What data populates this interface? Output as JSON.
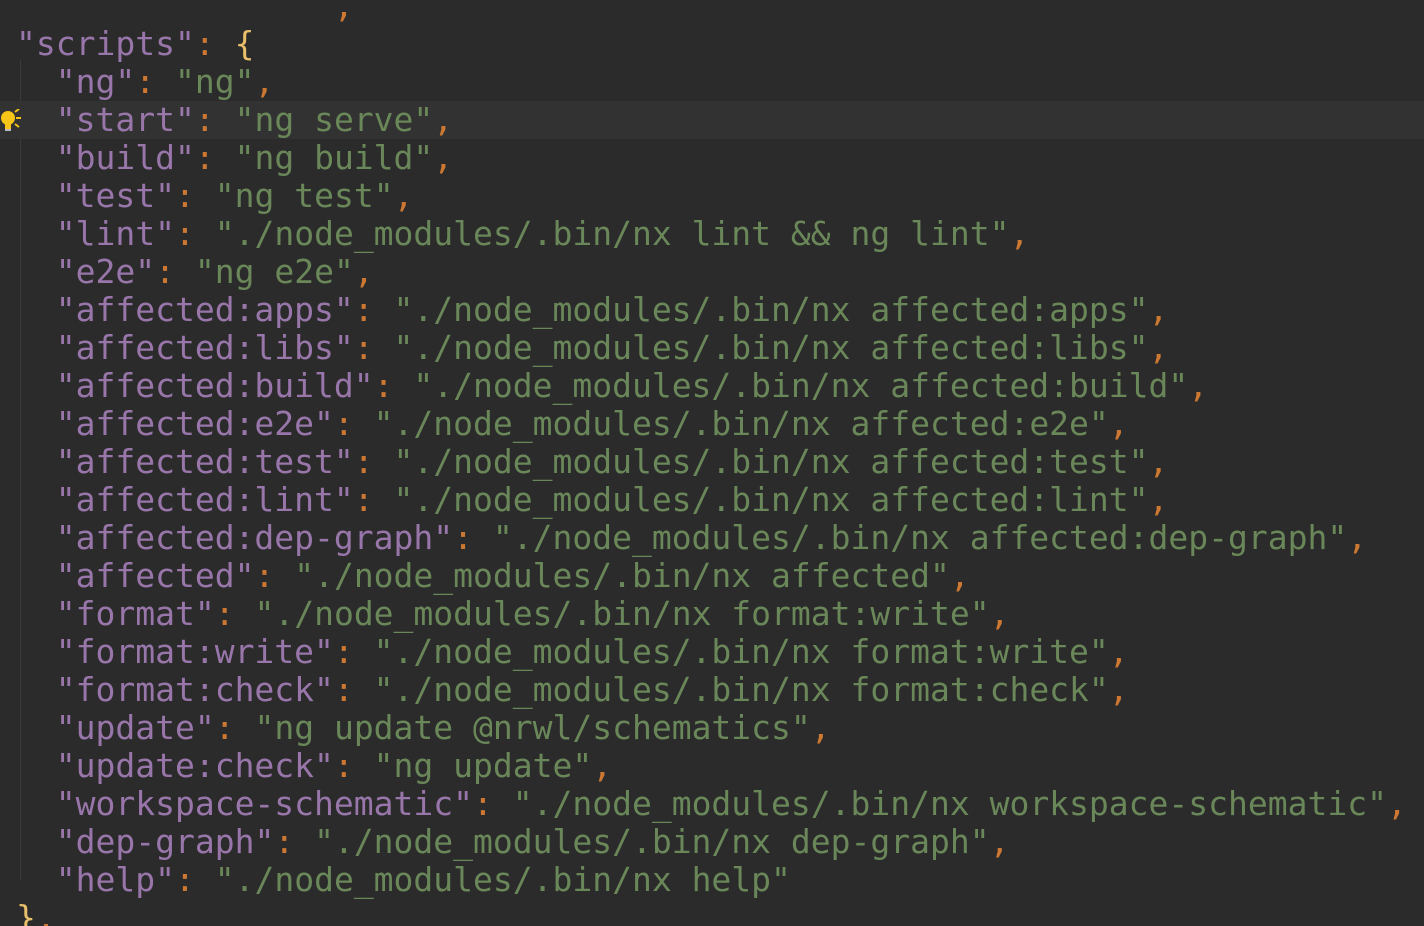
{
  "editor": {
    "lines": [
      {
        "indent": "",
        "key": "",
        "value": "",
        "comma": ",",
        "type": "partial-top"
      },
      {
        "indent": "",
        "key": "scripts",
        "open": "{",
        "type": "open"
      },
      {
        "indent": "  ",
        "key": "ng",
        "value": "ng",
        "comma": ","
      },
      {
        "indent": "  ",
        "key": "start",
        "value": "ng serve",
        "comma": ",",
        "current": true
      },
      {
        "indent": "  ",
        "key": "build",
        "value": "ng build",
        "comma": ","
      },
      {
        "indent": "  ",
        "key": "test",
        "value": "ng test",
        "comma": ","
      },
      {
        "indent": "  ",
        "key": "lint",
        "value": "./node_modules/.bin/nx lint && ng lint",
        "comma": ","
      },
      {
        "indent": "  ",
        "key": "e2e",
        "value": "ng e2e",
        "comma": ","
      },
      {
        "indent": "  ",
        "key": "affected:apps",
        "value": "./node_modules/.bin/nx affected:apps",
        "comma": ","
      },
      {
        "indent": "  ",
        "key": "affected:libs",
        "value": "./node_modules/.bin/nx affected:libs",
        "comma": ","
      },
      {
        "indent": "  ",
        "key": "affected:build",
        "value": "./node_modules/.bin/nx affected:build",
        "comma": ","
      },
      {
        "indent": "  ",
        "key": "affected:e2e",
        "value": "./node_modules/.bin/nx affected:e2e",
        "comma": ","
      },
      {
        "indent": "  ",
        "key": "affected:test",
        "value": "./node_modules/.bin/nx affected:test",
        "comma": ","
      },
      {
        "indent": "  ",
        "key": "affected:lint",
        "value": "./node_modules/.bin/nx affected:lint",
        "comma": ","
      },
      {
        "indent": "  ",
        "key": "affected:dep-graph",
        "value": "./node_modules/.bin/nx affected:dep-graph",
        "comma": ","
      },
      {
        "indent": "  ",
        "key": "affected",
        "value": "./node_modules/.bin/nx affected",
        "comma": ","
      },
      {
        "indent": "  ",
        "key": "format",
        "value": "./node_modules/.bin/nx format:write",
        "comma": ","
      },
      {
        "indent": "  ",
        "key": "format:write",
        "value": "./node_modules/.bin/nx format:write",
        "comma": ","
      },
      {
        "indent": "  ",
        "key": "format:check",
        "value": "./node_modules/.bin/nx format:check",
        "comma": ","
      },
      {
        "indent": "  ",
        "key": "update",
        "value": "ng update @nrwl/schematics",
        "comma": ","
      },
      {
        "indent": "  ",
        "key": "update:check",
        "value": "ng update",
        "comma": ","
      },
      {
        "indent": "  ",
        "key": "workspace-schematic",
        "value": "./node_modules/.bin/nx workspace-schematic",
        "comma": ","
      },
      {
        "indent": "  ",
        "key": "dep-graph",
        "value": "./node_modules/.bin/nx dep-graph",
        "comma": ","
      },
      {
        "indent": "  ",
        "key": "help",
        "value": "./node_modules/.bin/nx help",
        "comma": ""
      },
      {
        "indent": "",
        "close": "}",
        "comma": ",",
        "type": "close"
      }
    ]
  },
  "colors": {
    "background": "#2b2b2b",
    "current_line": "#323232",
    "key": "#9876aa",
    "string": "#6a8759",
    "punctuation": "#cc7832",
    "brace": "#e8bf6a",
    "bulb": "#f5c518"
  },
  "icons": {
    "intention": "lightbulb-icon"
  }
}
